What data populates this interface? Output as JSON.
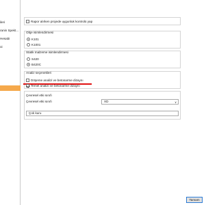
{
  "sidebar": {
    "items": [
      {
        "label": "ileri"
      },
      {
        "label": "ranin Spekt..."
      },
      {
        "label": "Hesabi"
      },
      {
        "label": "oi"
      },
      {
        "label": ""
      }
    ]
  },
  "project": {
    "checkbox_label": "Rapor alırken projede uygunluk kontrolü yap",
    "checked": false
  },
  "objects": {
    "title": "Obje isimlendirmesi",
    "options": [
      "K101",
      "K1001"
    ],
    "selected": 0
  },
  "static": {
    "title": "Statik malzeme isimlendirmesi",
    "options": [
      "S420",
      "B420C"
    ],
    "selected": 1
  },
  "analysis": {
    "title": "Analiz seçenekleri",
    "options": [
      {
        "label": "Döşeme analizi ve betonarme dizaynı",
        "checked": false
      },
      {
        "label": "Temel analizi ve betonarme dizaynı",
        "checked": true
      }
    ]
  },
  "env": {
    "title": "Çevresel etki sınıfı",
    "field_label": "Çevresel etki sınıfı",
    "select_value": "XD",
    "select_arrow": "∨",
    "text_value": "Çok kuru"
  },
  "footer": {
    "ok_label": "Tamam"
  }
}
